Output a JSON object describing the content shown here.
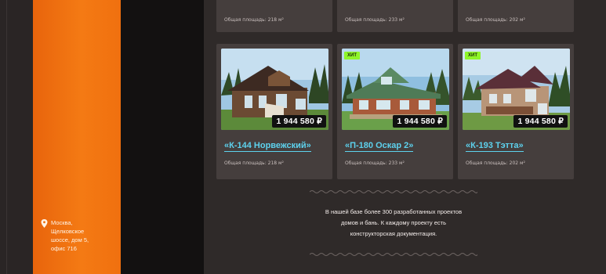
{
  "sidebar": {
    "address_lines": [
      "Москва,",
      "Щелковское",
      "шоссе, дом 5,",
      "офис 716"
    ]
  },
  "colors": {
    "accent_orange": "#f47a14",
    "link_cyan": "#5dd2ee",
    "hit_green": "#8ff52a"
  },
  "top_cards": [
    {
      "area": "Общая площадь: 218 м²"
    },
    {
      "area": "Общая площадь: 233 м²"
    },
    {
      "area": "Общая площадь: 202 м²"
    }
  ],
  "cards": [
    {
      "title": "«К-144 Норвежский»",
      "price": "1 944 580 ₽",
      "area": "Общая площадь: 218 м²",
      "badge": ""
    },
    {
      "title": "«П-180 Оскар 2»",
      "price": "1 944 580 ₽",
      "area": "Общая площадь: 233 м²",
      "badge": "ХИТ"
    },
    {
      "title": "«К-193 Тэтта»",
      "price": "1 944 580 ₽",
      "area": "Общая площадь: 202 м²",
      "badge": "ХИТ"
    }
  ],
  "info": {
    "lines": [
      "В нашей базе более 300 разработанных проектов",
      "домов и бань. К каждому проекту есть",
      "конструкторская документация."
    ]
  }
}
